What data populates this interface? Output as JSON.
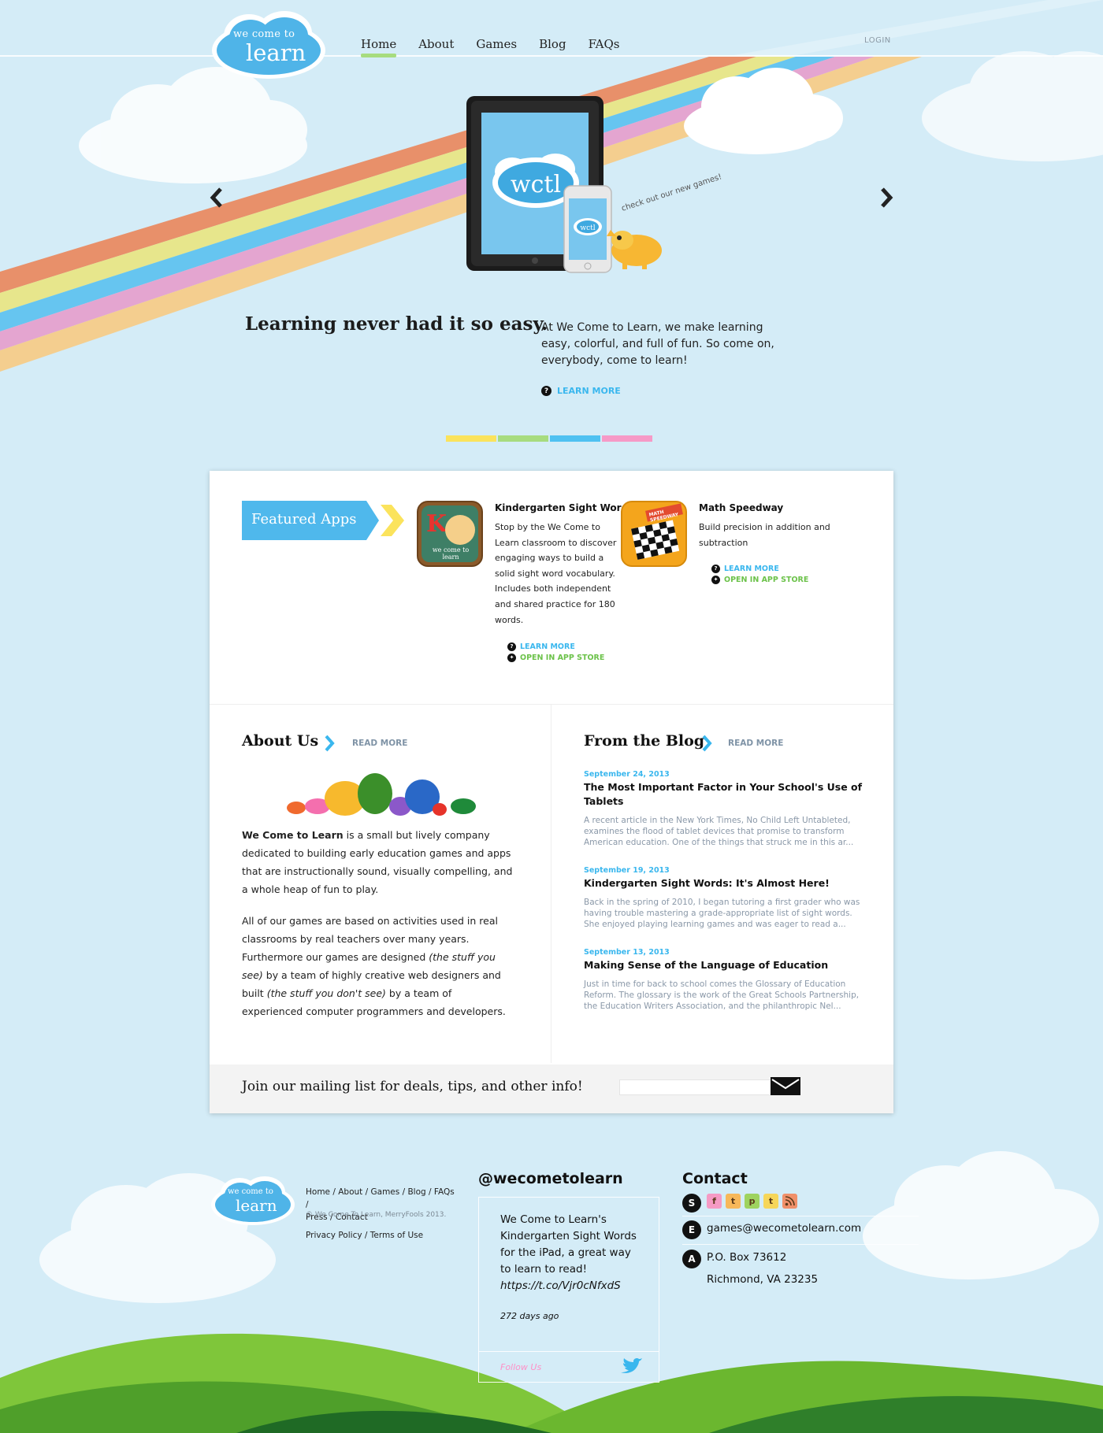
{
  "header": {
    "logo_line1": "we come to",
    "logo_line2": "learn",
    "nav": [
      "Home",
      "About",
      "Games",
      "Blog",
      "FAQs"
    ],
    "login": "LOGIN"
  },
  "hero": {
    "device_label": "wctl",
    "phone_label": "wctl",
    "doodle_text": "check out our new games!",
    "title": "Learning never had it so easy.",
    "description": "At We Come to Learn, we make learning easy, colorful, and full of fun. So come on, everybody, come to learn!",
    "learn_more": "LEARN MORE",
    "learn_more_icon": "question-icon",
    "slide_colors": [
      "#fbe35c",
      "#a7dc7f",
      "#4fc1f1",
      "#f69ac7"
    ]
  },
  "featured": {
    "label": "Featured Apps",
    "apps": [
      {
        "title": "Kindergarten Sight Words",
        "icon_text": "we come to learn",
        "description": "Stop by the We Come to Learn classroom to discover engaging ways to build a solid sight word vocabulary. Includes both independent and shared practice for 180 words.",
        "learn_more": "LEARN MORE",
        "app_store": "OPEN IN APP STORE"
      },
      {
        "title": "Math Speedway",
        "icon_text": "MATH SPEEDWAY",
        "description": "Build precision in addition and subtraction",
        "learn_more": "LEARN MORE",
        "app_store": "OPEN IN APP STORE"
      }
    ]
  },
  "about": {
    "title": "About Us",
    "read_more": "READ MORE",
    "p1_strong": "We Come to Learn",
    "p1_rest": " is a small but lively company dedicated to building early education games and apps that are instructionally sound, visually compelling, and a whole heap of fun to play.",
    "p2_a": "All of our games are based on activities used in real classrooms by real teachers over many years. Furthermore our games are designed ",
    "p2_em1": "(the stuff you see)",
    "p2_b": " by a team of highly creative web designers and built ",
    "p2_em2": "(the stuff you don't see)",
    "p2_c": " by a team of experienced computer programmers and developers."
  },
  "blog": {
    "title": "From the Blog",
    "read_more": "READ MORE",
    "posts": [
      {
        "date": "September 24, 2013",
        "title": "The Most Important Factor in Your School's Use of Tablets",
        "excerpt": "A recent article in the New York Times, No Child Left Untableted, examines the flood of tablet devices that promise to transform American education. One of the things that struck me in this ar..."
      },
      {
        "date": "September 19, 2013",
        "title": "Kindergarten Sight Words: It's Almost Here!",
        "excerpt": "Back in the spring of 2010, I began tutoring a first grader who was having trouble mastering a grade-appropriate list of sight words. She enjoyed playing learning games and was eager to read a..."
      },
      {
        "date": "September 13, 2013",
        "title": "Making Sense of the Language of Education",
        "excerpt": "Just in time for back to school comes the Glossary of Education Reform. The glossary is the work of the Great Schools Partnership, the Education Writers Association, and the philanthropic Nel..."
      }
    ]
  },
  "mailing": {
    "text": "Join our mailing list for deals, tips, and other info!",
    "input_value": "",
    "send_icon": "envelope-icon"
  },
  "footer": {
    "logo_line1": "we come to",
    "logo_line2": "learn",
    "links": [
      "Home",
      "About",
      "Games",
      "Blog",
      "FAQs",
      "Press",
      "Contact"
    ],
    "copyright": "© We Come To Learn, MerryFools 2013.",
    "privacy": "Privacy Policy",
    "terms": "Terms of Use",
    "twitter": {
      "handle": "@wecometolearn",
      "tweet": "We Come to Learn's Kindergarten Sight Words for the iPad, a great way to learn to read!",
      "link": "https://t.co/Vjr0cNfxdS",
      "time": "272 days ago",
      "follow": "Follow Us"
    },
    "contact": {
      "title": "Contact",
      "social_badge": "S",
      "social": [
        {
          "letter": "f",
          "name": "facebook-icon",
          "color": "#f59ac4"
        },
        {
          "letter": "t",
          "name": "tumblr-icon",
          "color": "#f7b85a"
        },
        {
          "letter": "p",
          "name": "pinterest-icon",
          "color": "#9ed35f"
        },
        {
          "letter": "t",
          "name": "twitter-icon",
          "color": "#f6d65a"
        },
        {
          "letter": "rss",
          "name": "rss-icon",
          "color": "#f0906a"
        }
      ],
      "email_badge": "E",
      "email": "games@wecometolearn.com",
      "address_badge": "A",
      "address1": "P.O. Box 73612",
      "address2": "Richmond, VA 23235"
    }
  }
}
